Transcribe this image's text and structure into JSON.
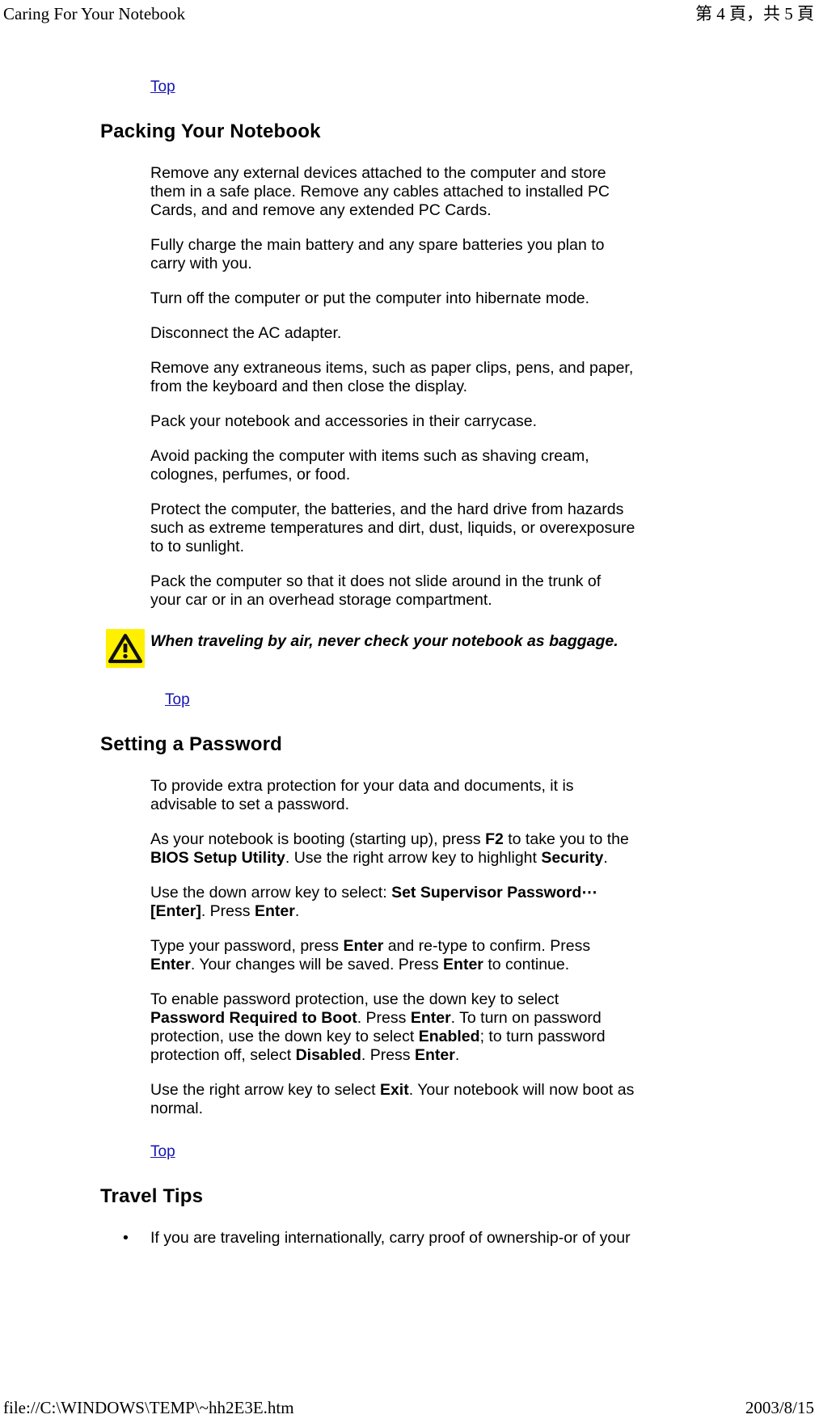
{
  "page": {
    "header_left": "Caring For Your Notebook",
    "header_right": "第 4 頁，共 5 頁",
    "footer_left": "file://C:\\WINDOWS\\TEMP\\~hh2E3E.htm",
    "footer_right": "2003/8/15"
  },
  "links": {
    "top_1": "Top",
    "top_2": "Top",
    "top_3": "Top"
  },
  "sections": {
    "packing": {
      "heading": "Packing Your Notebook",
      "paragraphs": [
        "Remove any external devices attached to the computer and store them in a safe place. Remove any cables attached to installed PC Cards, and and remove any extended PC Cards.",
        "Fully charge the main battery and any spare batteries you plan to carry with you.",
        "Turn off the computer or put the computer into hibernate mode.",
        "Disconnect the AC adapter.",
        "Remove any extraneous items, such as paper clips, pens, and paper, from the keyboard and then close the display.",
        "Pack your notebook and accessories in their carrycase.",
        "Avoid packing the computer with items such as shaving cream, colognes, perfumes, or food.",
        "Protect the computer, the batteries, and the hard drive from hazards such as extreme temperatures and dirt, dust, liquids, or overexposure to to sunlight.",
        "Pack the computer so that it does not slide around in the trunk of your car or in an overhead storage compartment."
      ],
      "warning": {
        "icon": "warning-triangle-icon",
        "icon_bg_color": "#fff000",
        "text": "When traveling by air, never check your notebook as baggage."
      }
    },
    "password": {
      "heading": "Setting a Password",
      "paragraphs": [
        {
          "runs": [
            {
              "text": "To provide extra protection for your data and documents, it is advisable to set a password.",
              "bold": false
            }
          ]
        },
        {
          "runs": [
            {
              "text": "As your notebook is booting (starting up), press ",
              "bold": false
            },
            {
              "text": "F2",
              "bold": true
            },
            {
              "text": " to take you to the ",
              "bold": false
            },
            {
              "text": "BIOS Setup Utility",
              "bold": true
            },
            {
              "text": ". Use the right arrow key to highlight ",
              "bold": false
            },
            {
              "text": "Security",
              "bold": true
            },
            {
              "text": ".",
              "bold": false
            }
          ]
        },
        {
          "runs": [
            {
              "text": "Use the down arrow key to select: ",
              "bold": false
            },
            {
              "text": "Set Supervisor Password⋯",
              "bold": true
            },
            {
              "text": " ",
              "bold": false
            },
            {
              "text": "[Enter]",
              "bold": true
            },
            {
              "text": ". Press ",
              "bold": false
            },
            {
              "text": "Enter",
              "bold": true
            },
            {
              "text": ".",
              "bold": false
            }
          ]
        },
        {
          "runs": [
            {
              "text": "Type your password, press ",
              "bold": false
            },
            {
              "text": "Enter",
              "bold": true
            },
            {
              "text": " and re-type to confirm. Press ",
              "bold": false
            },
            {
              "text": "Enter",
              "bold": true
            },
            {
              "text": ". Your changes will be saved. Press ",
              "bold": false
            },
            {
              "text": "Enter",
              "bold": true
            },
            {
              "text": " to continue.",
              "bold": false
            }
          ]
        },
        {
          "runs": [
            {
              "text": "To enable password protection, use the down key to select ",
              "bold": false
            },
            {
              "text": "Password Required to Boot",
              "bold": true
            },
            {
              "text": ". Press ",
              "bold": false
            },
            {
              "text": "Enter",
              "bold": true
            },
            {
              "text": ". To turn on password protection, use the down key to select ",
              "bold": false
            },
            {
              "text": "Enabled",
              "bold": true
            },
            {
              "text": "; to turn password protection off, select ",
              "bold": false
            },
            {
              "text": "Disabled",
              "bold": true
            },
            {
              "text": ". Press ",
              "bold": false
            },
            {
              "text": "Enter",
              "bold": true
            },
            {
              "text": ".",
              "bold": false
            }
          ]
        },
        {
          "runs": [
            {
              "text": "Use the right arrow key to select ",
              "bold": false
            },
            {
              "text": "Exit",
              "bold": true
            },
            {
              "text": ". Your notebook will now boot as normal.",
              "bold": false
            }
          ]
        }
      ]
    },
    "travel": {
      "heading": "Travel Tips",
      "bullet_char": "•",
      "items": [
        "If you are traveling internationally, carry proof of ownership-or of your"
      ]
    }
  }
}
